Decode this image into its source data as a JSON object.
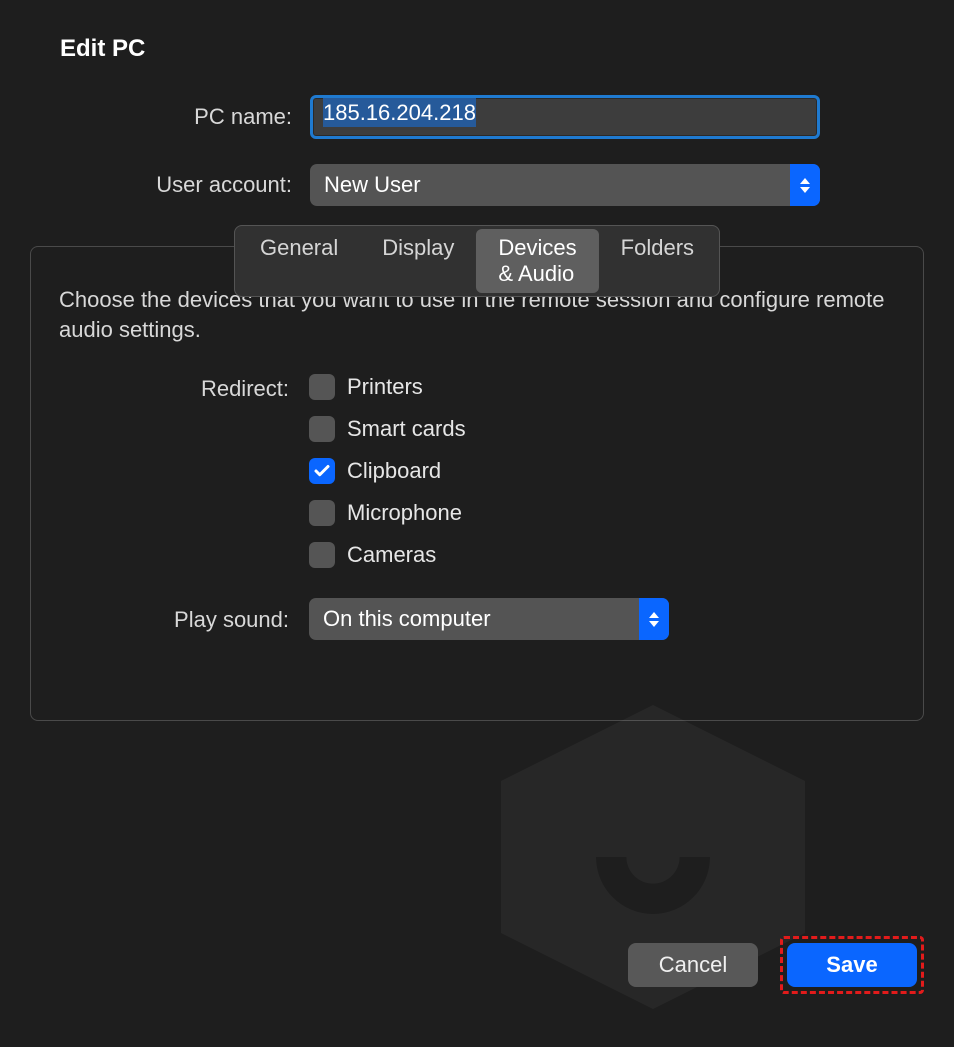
{
  "dialog": {
    "title": "Edit PC"
  },
  "form": {
    "pc_name_label": "PC name:",
    "pc_name_value": "185.16.204.218",
    "user_account_label": "User account:",
    "user_account_value": "New User"
  },
  "tabs": {
    "items": [
      "General",
      "Display",
      "Devices & Audio",
      "Folders"
    ],
    "active_index": 2
  },
  "devices_audio": {
    "description": "Choose the devices that you want to use in the remote session and configure remote audio settings.",
    "redirect_label": "Redirect:",
    "redirect_items": [
      {
        "label": "Printers",
        "checked": false
      },
      {
        "label": "Smart cards",
        "checked": false
      },
      {
        "label": "Clipboard",
        "checked": true
      },
      {
        "label": "Microphone",
        "checked": false
      },
      {
        "label": "Cameras",
        "checked": false
      }
    ],
    "play_sound_label": "Play sound:",
    "play_sound_value": "On this computer"
  },
  "footer": {
    "cancel": "Cancel",
    "save": "Save"
  }
}
